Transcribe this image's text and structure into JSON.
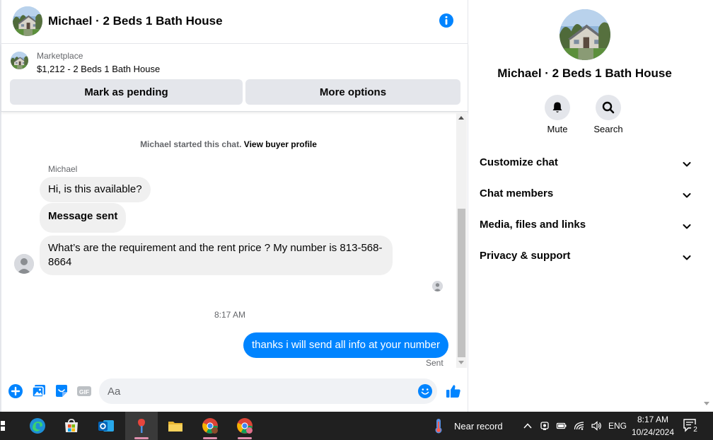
{
  "chat_header": {
    "title": "Michael · 2 Beds 1 Bath House"
  },
  "listing": {
    "category": "Marketplace",
    "name": "$1,212 - 2 Beds 1 Bath House",
    "mark_pending_label": "Mark as pending",
    "more_options_label": "More options"
  },
  "messages": {
    "system_text": "Michael started this chat.",
    "system_link": "View buyer profile",
    "sender_name": "Michael",
    "items": [
      {
        "from": "Michael",
        "text": "Hi, is this available?"
      },
      {
        "from": "Michael",
        "text": "Message sent"
      },
      {
        "from": "Michael",
        "text": "What’s are the requirement and the rent price ? My number is 813-568-8664"
      },
      {
        "from": "me",
        "text": "thanks i will send all info at your number"
      }
    ],
    "timestamp": "8:17 AM",
    "status": "Sent"
  },
  "composer": {
    "placeholder": "Aa"
  },
  "details": {
    "title": "Michael · 2 Beds 1 Bath House",
    "mute_label": "Mute",
    "search_label": "Search",
    "sections": [
      "Customize chat",
      "Chat members",
      "Media, files and links",
      "Privacy & support"
    ]
  },
  "taskbar": {
    "weather_text": "Near record",
    "language": "ENG",
    "time": "8:17 AM",
    "date": "10/24/2024",
    "notification_count": "2"
  },
  "colors": {
    "accent": "#0084ff",
    "incoming_bubble": "#f0f0f0",
    "button_bg": "#e4e6eb",
    "taskbar_bg": "#202020"
  },
  "icons": [
    "info-icon",
    "plus-icon",
    "photo-icon",
    "sticker-icon",
    "gif-icon",
    "emoji-icon",
    "like-icon",
    "bell-icon",
    "search-icon",
    "chevron-down-icon"
  ]
}
